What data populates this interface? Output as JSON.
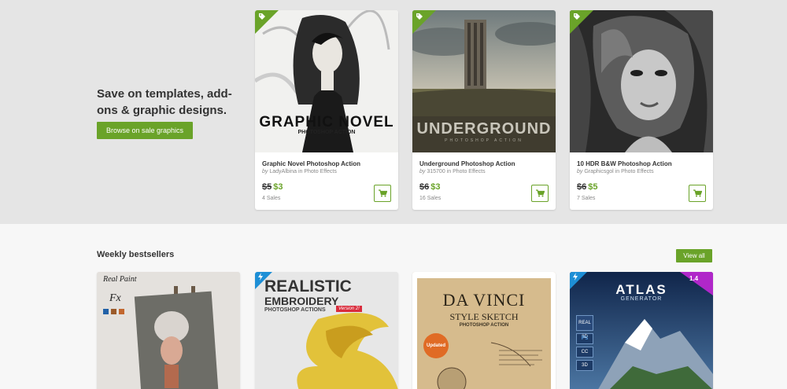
{
  "promo": {
    "title": "Save on templates, add-ons & graphic designs.",
    "button_label": "Browse on sale graphics"
  },
  "sale_items": [
    {
      "title": "Graphic Novel Photoshop Action",
      "by": "by",
      "author": "LadyAlbina",
      "category": "in Photo Effects",
      "old_price": "$5",
      "new_price": "$3",
      "sales": "4 Sales",
      "art_line1": "GRAPHIC NOVEL",
      "art_line2": "PHOTOSHOP ACTION"
    },
    {
      "title": "Underground Photoshop Action",
      "by": "by",
      "author": "315700",
      "category": "in Photo Effects",
      "old_price": "$6",
      "new_price": "$3",
      "sales": "16 Sales",
      "art_line1": "UNDERGROUND",
      "art_line2": "PHOTOSHOP ACTION"
    },
    {
      "title": "10 HDR B&W Photoshop Action",
      "by": "by",
      "author": "Graphicsgol",
      "category": "in Photo Effects",
      "old_price": "$6",
      "new_price": "$5",
      "sales": "7 Sales"
    }
  ],
  "bestsellers": {
    "title": "Weekly bestsellers",
    "view_all_label": "View all",
    "items": [
      {
        "art_line1": "Real Paint",
        "art_line2": "Fx"
      },
      {
        "art_line1": "REALISTIC",
        "art_line2": "EMBROIDERY",
        "art_line3": "PHOTOSHOP ACTIONS",
        "art_badge": "Version 2!"
      },
      {
        "art_line1": "DA VINCI",
        "art_line2": "STYLE SKETCH",
        "art_line3": "PHOTOSHOP ACTION",
        "art_badge": "Updated"
      },
      {
        "art_line1": "ATLAS",
        "art_line2": "GENERATOR",
        "art_badge": "1.4",
        "art_tiles": [
          "REAL 3D",
          "Ps",
          "CC",
          "3D"
        ]
      }
    ]
  },
  "icons": {
    "tag": "tag-icon",
    "cart": "cart-icon",
    "lightning": "lightning-icon"
  },
  "colors": {
    "accent": "#6aa329",
    "band": "#e5e5e5",
    "page": "#f7f7f7"
  }
}
